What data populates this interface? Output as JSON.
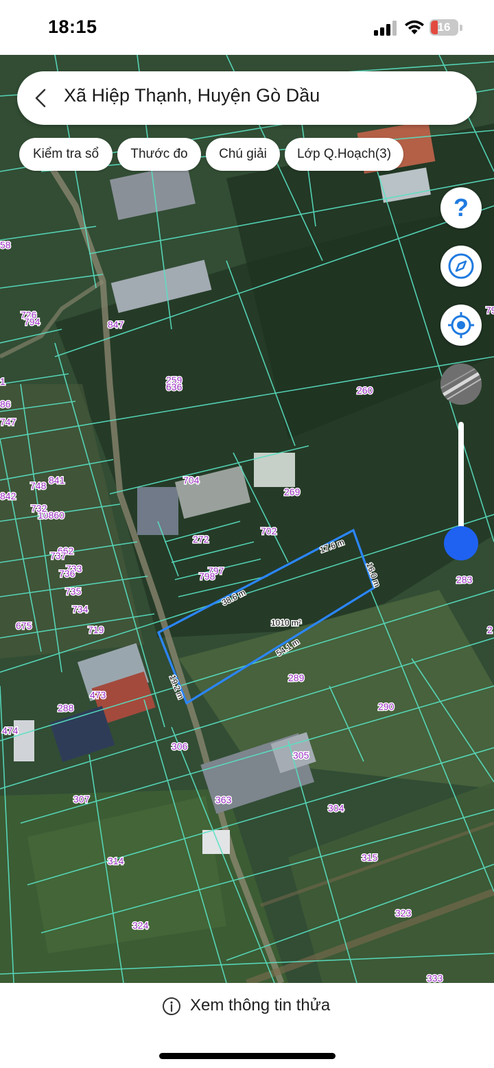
{
  "status_bar": {
    "time": "18:15",
    "battery": "16"
  },
  "search": {
    "title": "Xã Hiệp Thạnh, Huyện Gò Dầu"
  },
  "toolbar": {
    "check_book": "Kiểm tra sổ",
    "measure": "Thước đo",
    "legend": "Chú giải",
    "planning_layer": "Lớp Q.Hoạch(3)"
  },
  "map": {
    "parcel_labels": [
      "58",
      "726",
      "794",
      "847",
      "259",
      "636",
      "260",
      "79",
      "1",
      "86",
      "747",
      "748",
      "841",
      "842",
      "10860",
      "732",
      "704",
      "269",
      "272",
      "702",
      "662",
      "737",
      "733",
      "736",
      "797",
      "798",
      "735",
      "734",
      "675",
      "719",
      "283",
      "1010 m²",
      "289",
      "290",
      "473",
      "288",
      "474",
      "306",
      "305",
      "307",
      "363",
      "304",
      "314",
      "315",
      "324",
      "323",
      "333",
      "2"
    ],
    "dimensions": [
      "17.6 m",
      "16.0 m",
      "38.6 m",
      "54.1 m",
      "19.2 m"
    ],
    "colors": {
      "parcel_line": "#59e1c3",
      "label": "#9b2fc4",
      "selection": "#2b86ff"
    }
  },
  "controls": {
    "help_icon": "?",
    "compass_icon": "compass-icon",
    "locate_icon": "locate-icon",
    "zoom_level": 0.1
  },
  "bottom": {
    "info_text": "Xem thông tin thửa"
  }
}
